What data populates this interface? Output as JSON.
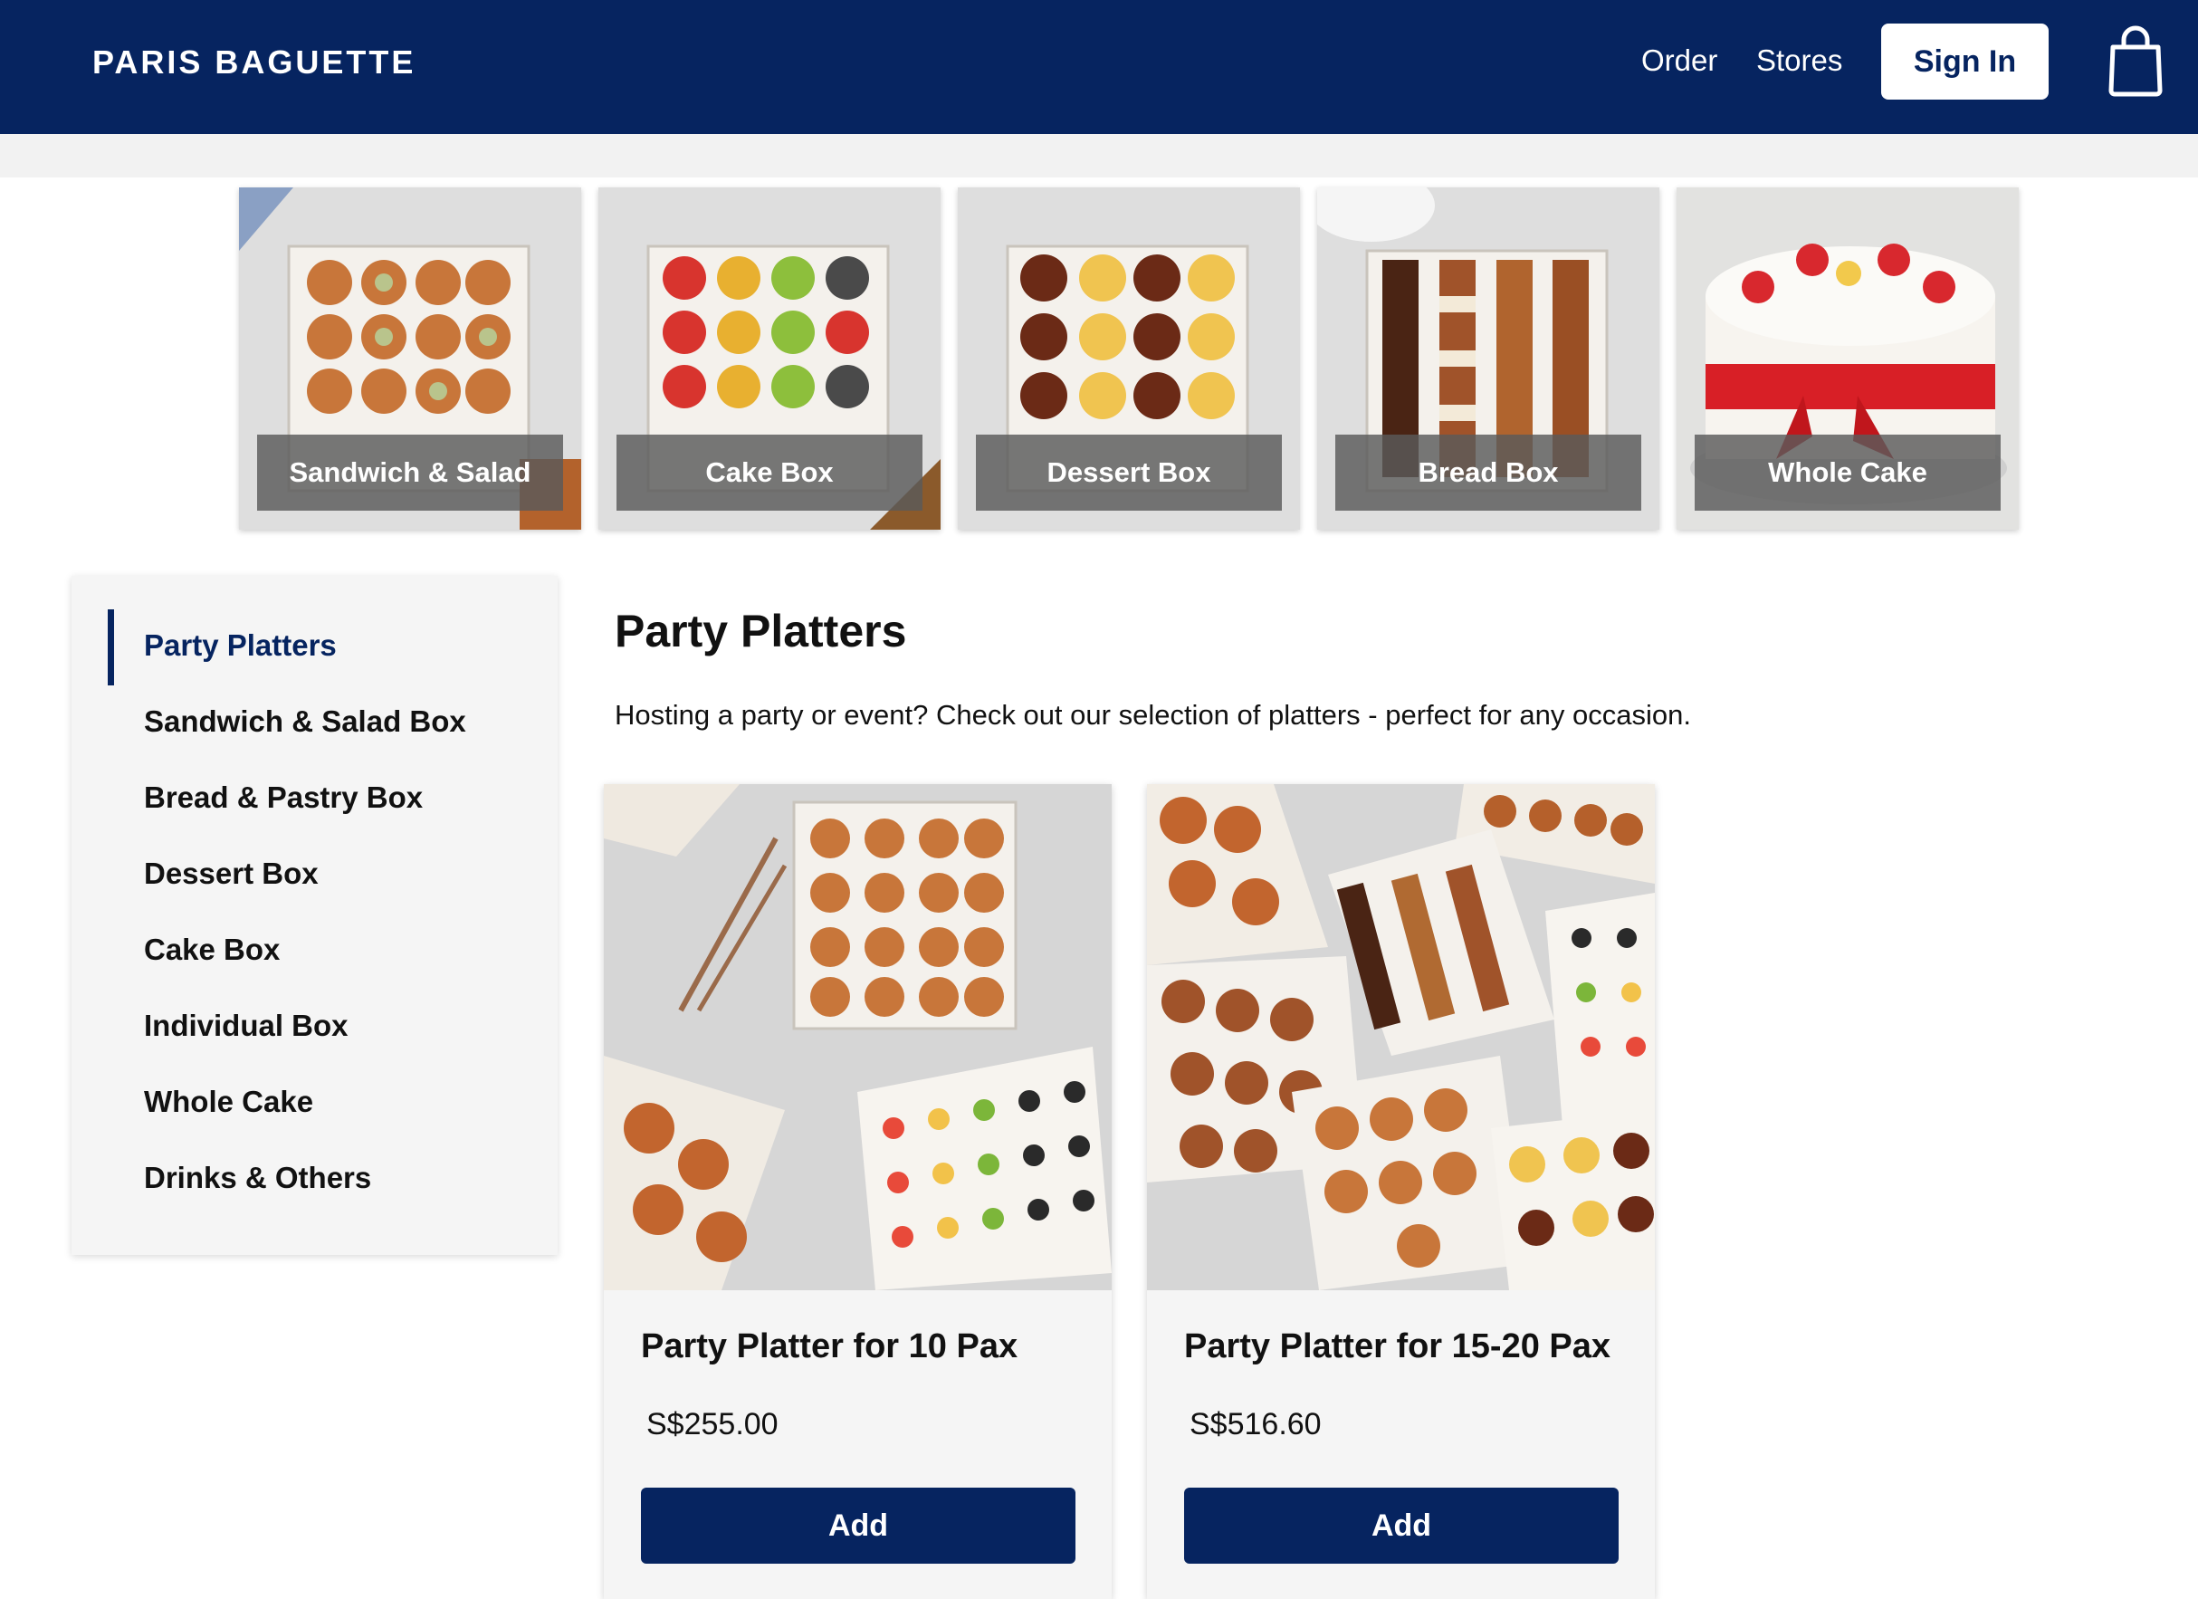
{
  "header": {
    "logo": "PARIS BAGUETTE",
    "nav": [
      "Order",
      "Stores"
    ],
    "sign_in": "Sign In",
    "cart_icon": "shopping-bag-icon"
  },
  "categories": [
    {
      "label": "Sandwich & Salad"
    },
    {
      "label": "Cake Box"
    },
    {
      "label": "Dessert Box"
    },
    {
      "label": "Bread Box"
    },
    {
      "label": "Whole Cake"
    }
  ],
  "sidebar": {
    "items": [
      {
        "label": "Party Platters",
        "active": true
      },
      {
        "label": "Sandwich & Salad Box"
      },
      {
        "label": "Bread & Pastry Box"
      },
      {
        "label": "Dessert Box"
      },
      {
        "label": "Cake Box"
      },
      {
        "label": "Individual Box"
      },
      {
        "label": "Whole Cake"
      },
      {
        "label": "Drinks & Others"
      }
    ]
  },
  "main": {
    "title": "Party Platters",
    "subtitle": "Hosting a party or event? Check out our selection of platters - perfect for any occasion.",
    "products": [
      {
        "name": "Party Platter for 10 Pax",
        "price": "S$255.00",
        "button": "Add"
      },
      {
        "name": "Party Platter for 15-20 Pax",
        "price": "S$516.60",
        "button": "Add"
      }
    ]
  },
  "colors": {
    "brand_navy": "#062460",
    "panel_gray": "#f5f5f5"
  }
}
